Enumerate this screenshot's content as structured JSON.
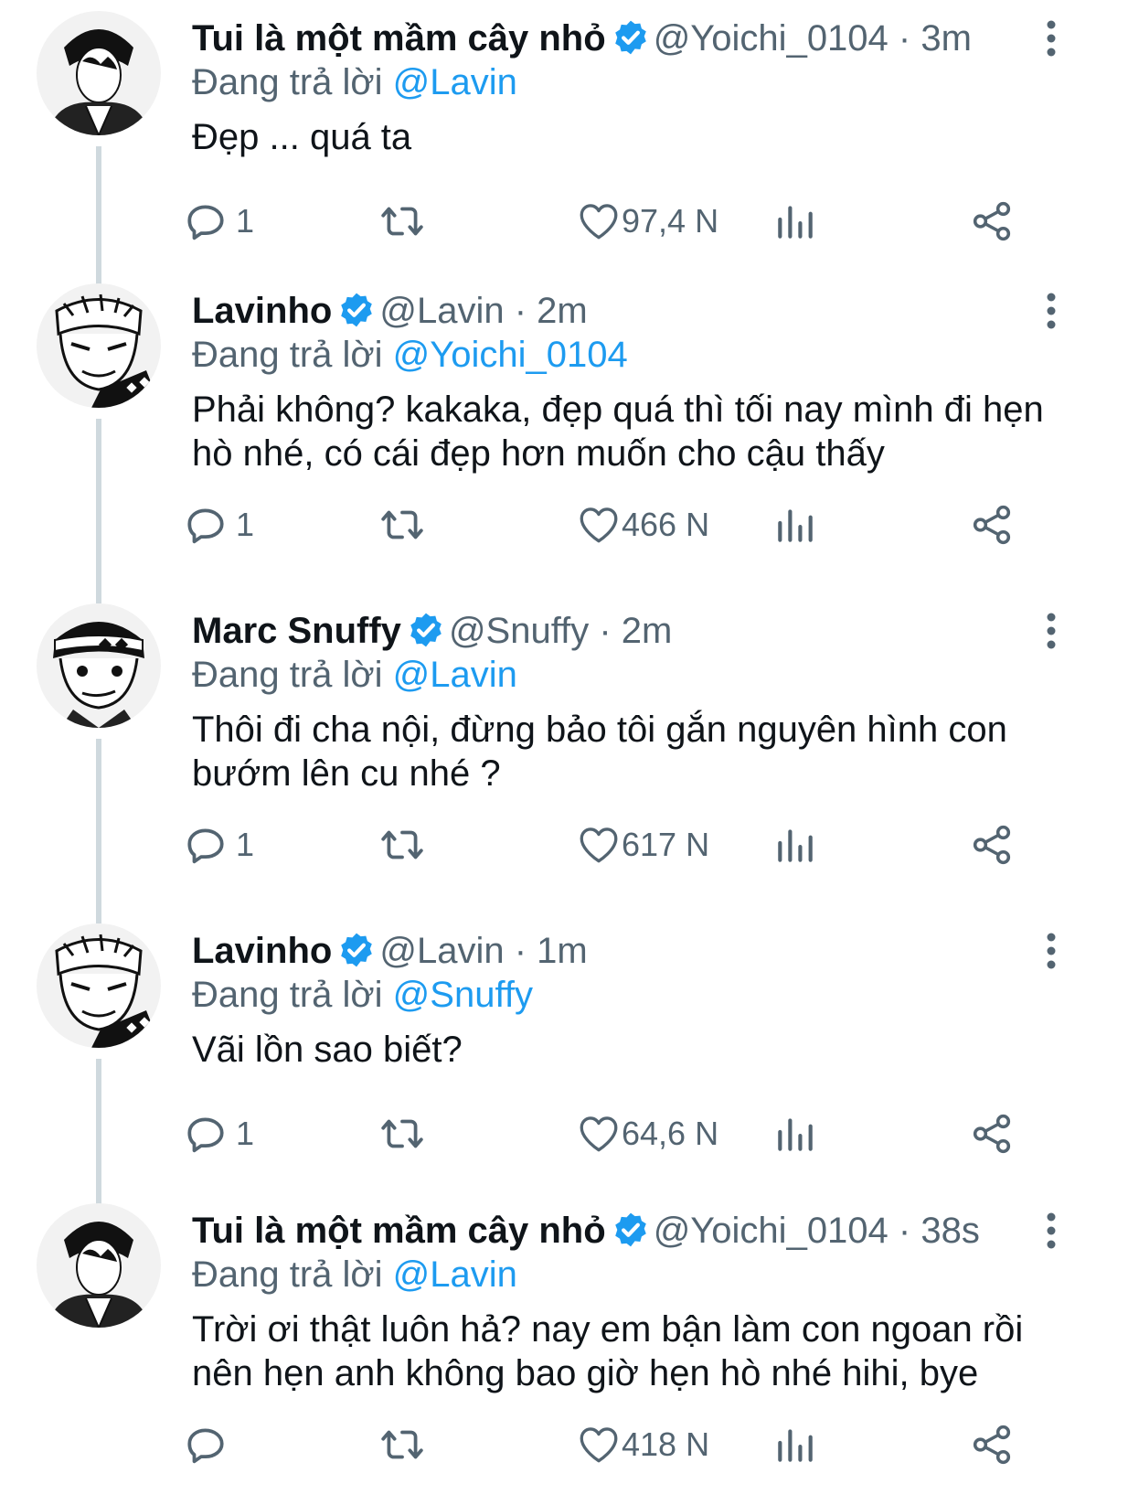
{
  "colors": {
    "accent": "#1d9bf0",
    "muted": "#536471",
    "text": "#0f1419",
    "thread": "#cfd9de"
  },
  "reply_prefix": "Đang trả lời",
  "tweets": [
    {
      "name": "Tui là một mầm cây nhỏ",
      "handle": "@Yoichi_0104",
      "time": "3m",
      "reply_to": "@Lavin",
      "text": "Đẹp ... quá ta",
      "replies": "1",
      "likes": "97,4 N"
    },
    {
      "name": "Lavinho",
      "handle": "@Lavin",
      "time": "2m",
      "reply_to": "@Yoichi_0104",
      "text": "Phải không? kakaka, đẹp quá thì tối nay mình đi hẹn hò nhé, có cái đẹp hơn muốn cho cậu thấy",
      "replies": "1",
      "likes": "466 N"
    },
    {
      "name": "Marc Snuffy",
      "handle": "@Snuffy",
      "time": "2m",
      "reply_to": "@Lavin",
      "text": "Thôi đi cha nội, đừng bảo tôi gắn nguyên hình con bướm lên cu nhé ?",
      "replies": "1",
      "likes": "617 N"
    },
    {
      "name": "Lavinho",
      "handle": "@Lavin",
      "time": "1m",
      "reply_to": "@Snuffy",
      "text": "Vãi lồn sao biết?",
      "replies": "1",
      "likes": "64,6 N"
    },
    {
      "name": "Tui là một mầm cây nhỏ",
      "handle": "@Yoichi_0104",
      "time": "38s",
      "reply_to": "@Lavin",
      "text": "Trời ơi thật luôn hả? nay em bận làm con ngoan rồi nên hẹn anh không bao giờ hẹn hò nhé hihi, bye",
      "replies": "",
      "likes": "418 N"
    }
  ],
  "icons": {
    "reply": "reply-icon",
    "retweet": "retweet-icon",
    "like": "heart-icon",
    "views": "analytics-icon",
    "share": "share-icon",
    "menu": "more-options-icon",
    "verified": "verified-badge-icon"
  }
}
